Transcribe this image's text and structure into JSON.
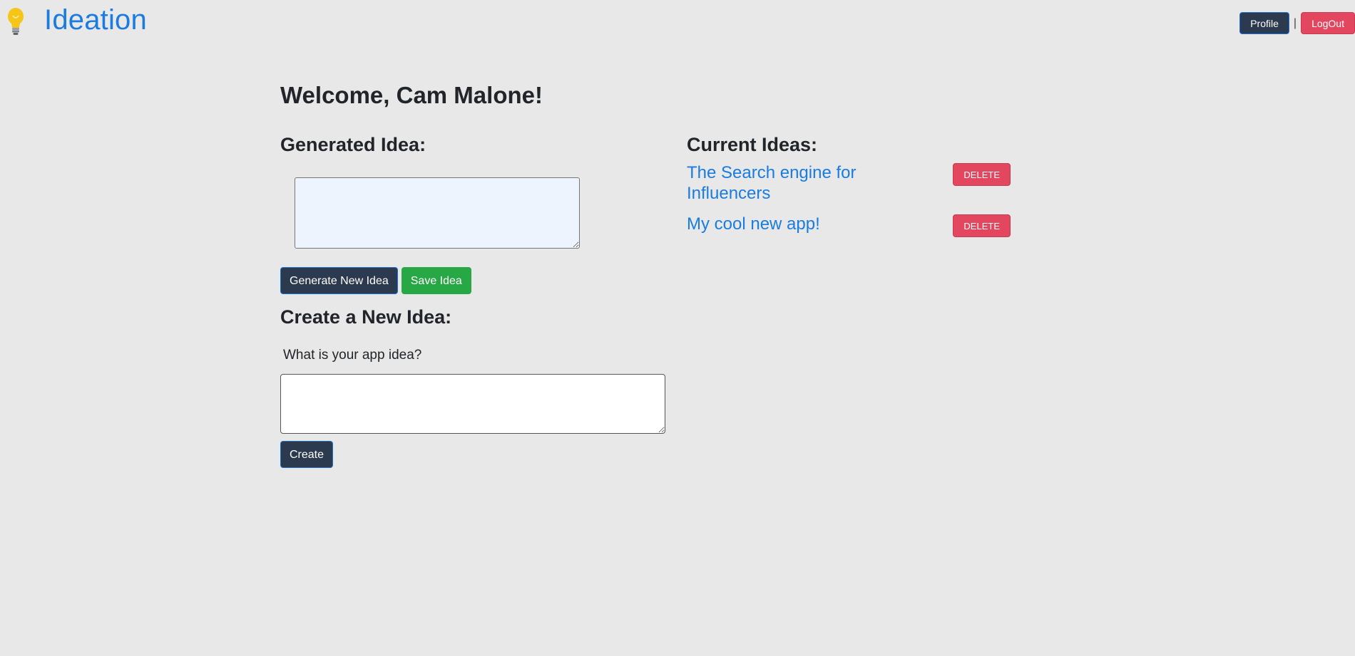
{
  "header": {
    "brand": "Ideation",
    "logo_icon": "lightbulb-icon",
    "profile_label": "Profile",
    "separator": "|",
    "logout_label": "LogOut"
  },
  "main": {
    "welcome": "Welcome, Cam Malone!",
    "generated_heading": "Generated Idea:",
    "generated_value": "",
    "generate_button": "Generate New Idea",
    "save_button": "Save Idea",
    "create_heading": "Create a New Idea:",
    "create_label": "What is your app idea?",
    "create_value": "",
    "create_button": "Create"
  },
  "ideas": {
    "heading": "Current Ideas:",
    "items": [
      {
        "title": "The Search engine for Influencers",
        "delete_label": "DELETE"
      },
      {
        "title": "My cool new app!",
        "delete_label": "DELETE"
      }
    ]
  },
  "colors": {
    "background": "#e8e8e8",
    "brand_blue": "#1a7ce0",
    "dark_button": "#2b3a4e",
    "danger_button": "#e2475f",
    "success_button": "#28a745",
    "generated_box_bg": "#edf4fd"
  }
}
